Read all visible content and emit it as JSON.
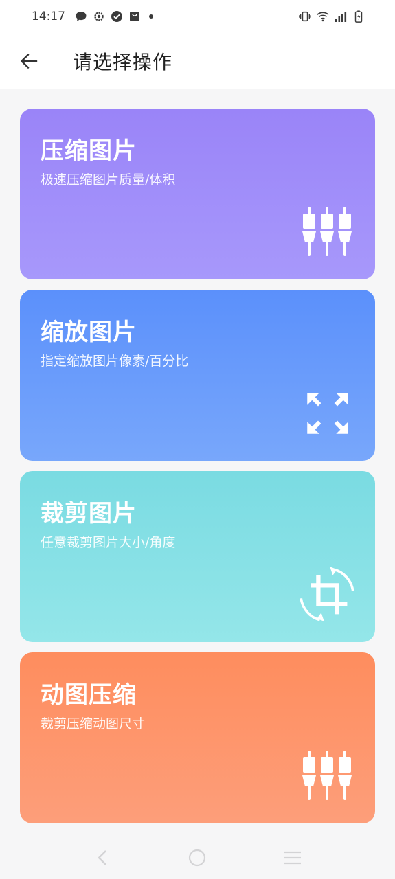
{
  "status_bar": {
    "time": "14:17",
    "left_icons": [
      "chat-icon",
      "gear-icon",
      "check-circle-icon",
      "bag-icon",
      "dot-icon"
    ],
    "right_icons": [
      "vibrate-icon",
      "wifi-icon",
      "signal-icon",
      "battery-icon"
    ]
  },
  "header": {
    "back_icon": "arrow-left-icon",
    "title": "请选择操作"
  },
  "cards": [
    {
      "title": "压缩图片",
      "subtitle": "极速压缩图片质量/体积",
      "icon": "equalizer-icon",
      "gradient": [
        "#9a84f8",
        "#a798fb"
      ]
    },
    {
      "title": "缩放图片",
      "subtitle": "指定缩放图片像素/百分比",
      "icon": "expand-icon",
      "gradient": [
        "#5b90fb",
        "#78a7fb"
      ]
    },
    {
      "title": "裁剪图片",
      "subtitle": "任意裁剪图片大小/角度",
      "icon": "crop-rotate-icon",
      "gradient": [
        "#7adbe2",
        "#94e6e9"
      ]
    },
    {
      "title": "动图压缩",
      "subtitle": "裁剪压缩动图尺寸",
      "icon": "equalizer-icon",
      "gradient": [
        "#fe8d5e",
        "#fd9e7a"
      ]
    }
  ],
  "nav_bar": {
    "items": [
      "back-triangle-icon",
      "home-circle-icon",
      "menu-lines-icon"
    ]
  }
}
